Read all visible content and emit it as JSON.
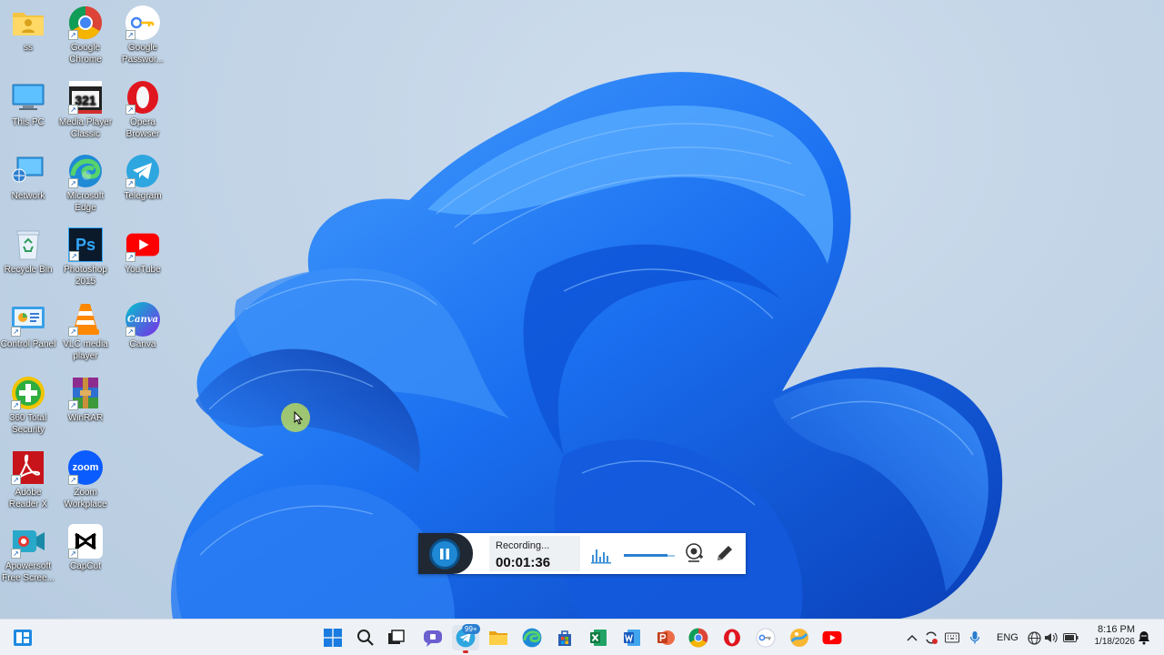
{
  "desktop": {
    "icons": [
      {
        "label": "ss",
        "icon": "user-folder-icon"
      },
      {
        "label": "Google Chrome",
        "icon": "chrome-icon"
      },
      {
        "label": "Google Passwor...",
        "icon": "google-password-icon"
      },
      {
        "label": "This PC",
        "icon": "this-pc-icon"
      },
      {
        "label": "Media Player Classic",
        "icon": "media-player-icon"
      },
      {
        "label": "Opera Browser",
        "icon": "opera-icon"
      },
      {
        "label": "Network",
        "icon": "network-icon"
      },
      {
        "label": "Microsoft Edge",
        "icon": "edge-icon"
      },
      {
        "label": "Telegram",
        "icon": "telegram-icon"
      },
      {
        "label": "Recycle Bin",
        "icon": "recycle-bin-icon"
      },
      {
        "label": "Photoshop 2015",
        "icon": "photoshop-icon",
        "glyph": "Ps"
      },
      {
        "label": "YouTube",
        "icon": "youtube-icon"
      },
      {
        "label": "Control Panel",
        "icon": "control-panel-icon"
      },
      {
        "label": "VLC media player",
        "icon": "vlc-icon"
      },
      {
        "label": "Canva",
        "icon": "canva-icon",
        "glyph": "Canva"
      },
      {
        "label": "360 Total Security",
        "icon": "360-security-icon"
      },
      {
        "label": "WinRAR",
        "icon": "winrar-icon"
      },
      {
        "label": "Adobe Reader X",
        "icon": "adobe-reader-icon"
      },
      {
        "label": "Zoom Workplace",
        "icon": "zoom-icon",
        "glyph": "zoom"
      },
      {
        "label": "Apowersoft Free Scree...",
        "icon": "apowersoft-icon"
      },
      {
        "label": "CapCut",
        "icon": "capcut-icon"
      }
    ]
  },
  "recorder": {
    "status": "Recording...",
    "time": "00:01:36",
    "pause_icon": "pause-icon",
    "audio_icon": "audio-level-icon",
    "webcam_icon": "webcam-icon",
    "pen_icon": "pen-icon",
    "volume_level": 0.85
  },
  "taskbar": {
    "widgets_icon": "widgets-icon",
    "start_icon": "windows-start-icon",
    "search_icon": "search-icon",
    "task_view_icon": "task-view-icon",
    "apps": [
      {
        "icon": "teams-chat-icon"
      },
      {
        "icon": "telegram-icon",
        "badge": "99+",
        "active": true
      },
      {
        "icon": "file-explorer-icon"
      },
      {
        "icon": "edge-icon"
      },
      {
        "icon": "microsoft-store-icon"
      },
      {
        "icon": "excel-icon"
      },
      {
        "icon": "word-icon"
      },
      {
        "icon": "powerpoint-icon"
      },
      {
        "icon": "chrome-icon"
      },
      {
        "icon": "opera-icon"
      },
      {
        "icon": "google-password-icon"
      },
      {
        "icon": "photos-icon"
      },
      {
        "icon": "youtube-icon"
      }
    ],
    "tray": {
      "chevron_icon": "chevron-up-icon",
      "language": "ENG",
      "time": "8:16 PM",
      "date": "1/18/2026"
    }
  },
  "colors": {
    "accent": "#1e88d4",
    "wallpaper_blue": "#1565e8",
    "taskbar": "#eef2f7"
  }
}
